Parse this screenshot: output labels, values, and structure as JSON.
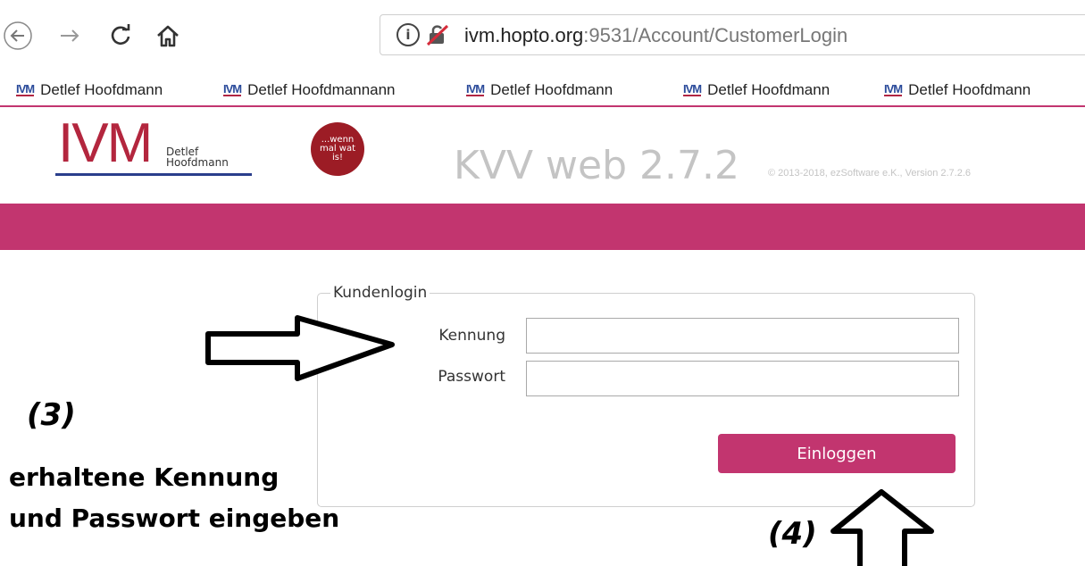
{
  "browser": {
    "url_host": "ivm.hopto.org",
    "url_rest": ":9531/Account/CustomerLogin",
    "bookmarks": [
      {
        "logo": "IVM",
        "label": "Detlef Hoofdmann"
      },
      {
        "logo": "IVM",
        "label": "Detlef Hoofdmannann"
      },
      {
        "logo": "IVM",
        "label": "Detlef Hoofdmann"
      },
      {
        "logo": "IVM",
        "label": "Detlef Hoofdmann"
      },
      {
        "logo": "IVM",
        "label": "Detlef Hoofdmann"
      }
    ],
    "icons": [
      "back-icon",
      "forward-icon",
      "reload-icon",
      "home-icon",
      "info-icon",
      "insecure-connection-icon"
    ]
  },
  "header": {
    "logo_mark": "IVM",
    "logo_sub1": "Detlef",
    "logo_sub2": "Hoofdmann",
    "badge_line1": "...wenn",
    "badge_line2": "mal wat",
    "badge_line3": "is!",
    "app_title": "KVV web 2.7.2",
    "copyright": "© 2013-2018, ezSoftware e.K., Version 2.7.2.6",
    "accent_color": "#c2356f"
  },
  "login": {
    "legend": "Kundenlogin",
    "username_label": "Kennung",
    "username_value": "",
    "password_label": "Passwort",
    "password_value": "",
    "submit_label": "Einloggen"
  },
  "annotations": {
    "step3": "(3)",
    "instruction_line1": "erhaltene Kennung",
    "instruction_line2": "und Passwort eingeben",
    "step4": "(4)"
  }
}
